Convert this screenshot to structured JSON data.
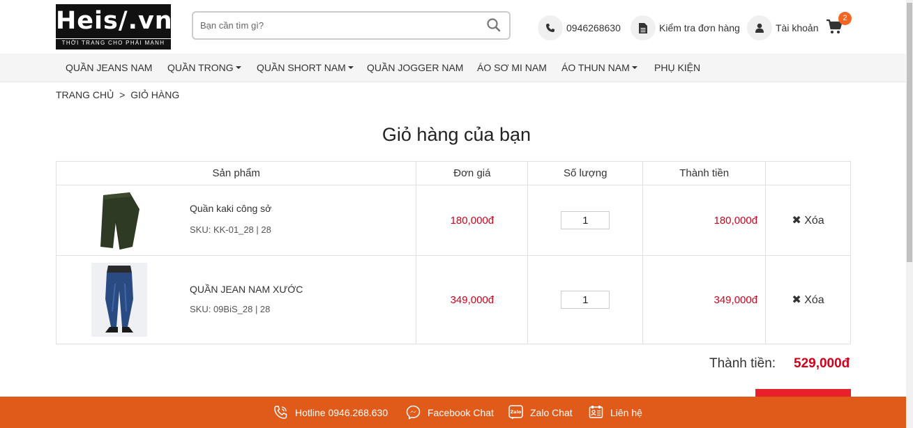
{
  "header": {
    "logo_text": "Heis/.vn",
    "logo_tagline": "THỜI TRANG CHO PHÁI MẠNH",
    "search_placeholder": "Bạn cần tìm gì?",
    "phone": "0946268630",
    "order_check": "Kiểm tra đơn hàng",
    "account": "Tài khoản",
    "cart_count": "2"
  },
  "nav": {
    "items": [
      {
        "label": "QUẦN JEANS NAM",
        "dropdown": false
      },
      {
        "label": "QUẦN TRONG",
        "dropdown": true
      },
      {
        "label": "QUẦN SHORT NAM",
        "dropdown": true
      },
      {
        "label": "QUẦN JOGGER NAM",
        "dropdown": false
      },
      {
        "label": "ÁO SƠ MI NAM",
        "dropdown": false
      },
      {
        "label": "ÁO THUN NAM",
        "dropdown": true
      },
      {
        "label": "PHỤ KIỆN",
        "dropdown": false
      }
    ]
  },
  "breadcrumb": {
    "home": "TRANG CHỦ",
    "separator": ">",
    "current": "GIỎ HÀNG"
  },
  "page_title": "Giỏ hàng của bạn",
  "table": {
    "headers": [
      "Sản phẩm",
      "Đơn giá",
      "Số lượng",
      "Thành tiền",
      ""
    ],
    "rows": [
      {
        "name": "Quần kaki công sở",
        "sku": "SKU: KK-01_28 | 28",
        "price": "180,000đ",
        "qty": "1",
        "total": "180,000đ",
        "delete": "Xóa"
      },
      {
        "name": "QUẦN JEAN NAM XƯỚC",
        "sku": "SKU: 09BiS_28 | 28",
        "price": "349,000đ",
        "qty": "1",
        "total": "349,000đ",
        "delete": "Xóa"
      }
    ]
  },
  "summary": {
    "label": "Thành tiền:",
    "value": "529,000đ"
  },
  "footer_bar": {
    "hotline": "Hotline 0946.268.630",
    "facebook": "Facebook Chat",
    "zalo": "Zalo Chat",
    "zalo_icon_text": "Zalo",
    "contact": "Liên hệ"
  },
  "colors": {
    "accent_orange": "#e05a1a",
    "price_red": "#d0021b",
    "badge_orange": "#f26522"
  }
}
